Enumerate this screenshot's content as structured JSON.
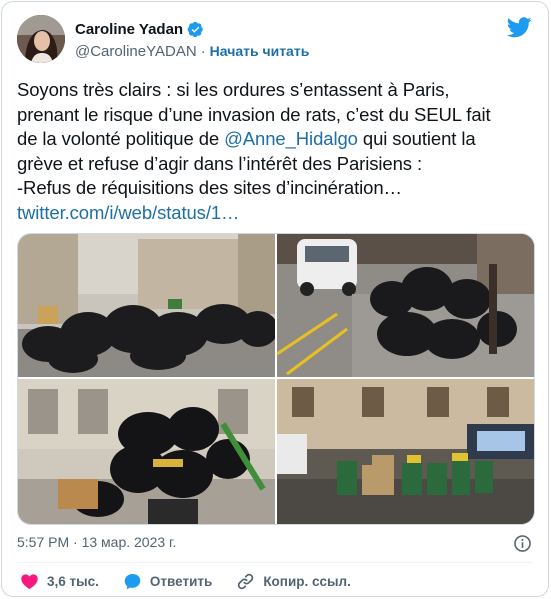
{
  "author": {
    "name": "Caroline Yadan",
    "handle": "@CarolineYADAN",
    "separator": "·",
    "follow_label": "Начать читать"
  },
  "tweet": {
    "line1": "Soyons très clairs : si les ordures s’entassent à Paris,",
    "line2": "prenant le risque d’une invasion de rats, c’est du SEUL fait",
    "line3_before": "de la volonté politique de ",
    "line3_mention": "@Anne_Hidalgo",
    "line3_after": " qui  soutient la",
    "line4": "grève et refuse d’agir dans l’intérêt des Parisiens :",
    "line5": "-Refus de réquisitions des sites d’incinération…",
    "link": "twitter.com/i/web/status/1…"
  },
  "timestamp": "5:57 PM · 13 мар. 2023 г.",
  "actions": {
    "likes": "3,6 тыс.",
    "reply": "Ответить",
    "copy_link": "Копир. ссыл."
  },
  "icons": {
    "verified": "verified-badge-icon",
    "logo": "twitter-bird-icon",
    "info": "info-icon",
    "like": "heart-icon",
    "reply": "reply-bubble-icon",
    "copy": "link-icon"
  },
  "colors": {
    "accent": "#1d9bf0",
    "link": "#1d6fa5",
    "like": "#f91880",
    "text": "#0f1419",
    "secondary": "#536471"
  }
}
